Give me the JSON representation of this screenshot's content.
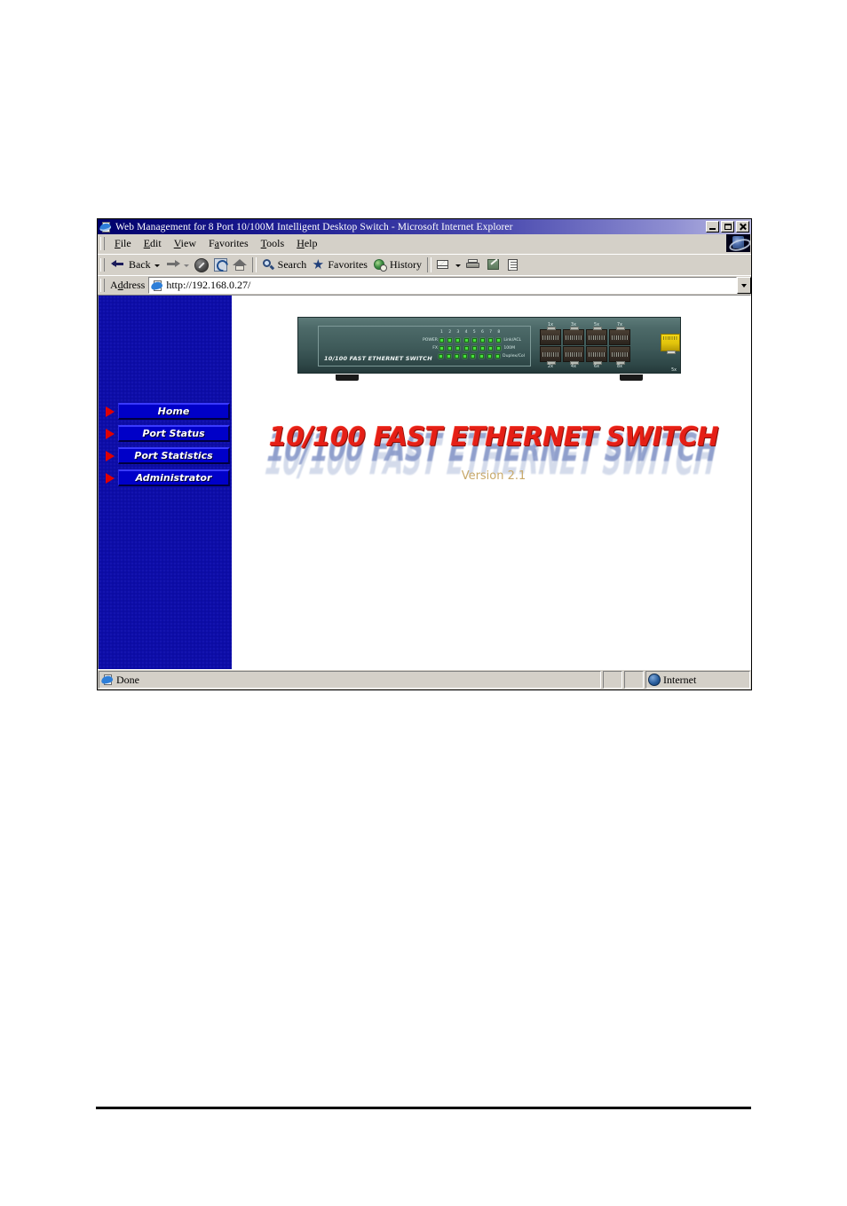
{
  "window": {
    "title": "Web Management for 8 Port 10/100M Intelligent Desktop Switch - Microsoft Internet Explorer",
    "icon": "ie-document-icon",
    "controls": {
      "minimize": "_",
      "restore": "□",
      "close": "✕"
    }
  },
  "menu": {
    "items": [
      {
        "accel": "F",
        "rest": "ile"
      },
      {
        "accel": "E",
        "rest": "dit"
      },
      {
        "accel": "V",
        "rest": "iew"
      },
      {
        "pre": "F",
        "accel": "a",
        "rest": "vorites"
      },
      {
        "accel": "T",
        "rest": "ools"
      },
      {
        "accel": "H",
        "rest": "elp"
      }
    ],
    "labels": [
      "File",
      "Edit",
      "View",
      "Favorites",
      "Tools",
      "Help"
    ]
  },
  "toolbar": {
    "back": "Back",
    "forward": "",
    "stop": "",
    "refresh": "",
    "home": "",
    "search": "Search",
    "favorites": "Favorites",
    "history": "History",
    "mail": "",
    "print": "",
    "edit": "",
    "discuss": ""
  },
  "address": {
    "label_pre": "A",
    "label_accel": "d",
    "label_post": "dress",
    "label": "Address",
    "url": "http://192.168.0.27/",
    "placeholder": "http://"
  },
  "sidebar": {
    "items": [
      {
        "label": "Home"
      },
      {
        "label": "Port Status"
      },
      {
        "label": "Port Statistics"
      },
      {
        "label": "Administrator"
      }
    ]
  },
  "content": {
    "device": {
      "brand": "10/100 FAST ETHERNET SWITCH",
      "port_numbers_top": [
        "1x",
        "3x",
        "5x",
        "7x"
      ],
      "port_numbers_bottom": [
        "2x",
        "4x",
        "6x",
        "8x"
      ],
      "uplink_label": "5x",
      "led_column_numbers": [
        "1",
        "2",
        "3",
        "4",
        "5",
        "6",
        "7",
        "8"
      ],
      "led_rows": [
        {
          "left": "POWER",
          "right": "Link/ACL"
        },
        {
          "left": "FX",
          "right": "100M"
        },
        {
          "left": "",
          "right": "Duplex/Col"
        }
      ]
    },
    "banner_title": "10/100 FAST ETHERNET SWITCH",
    "version": "Version 2.1"
  },
  "statusbar": {
    "status": "Done",
    "zone": "Internet"
  },
  "colors": {
    "titlebar_start": "#00006b",
    "titlebar_end": "#b9b9e2",
    "chrome": "#d4d0c8",
    "sidebar_bg": "#0d0da8",
    "nav_button": "#0000c8",
    "nav_bullet": "#e00000",
    "banner_red": "#e51f16",
    "banner_shadow_blue": "#7d8fc4",
    "version_tan": "#c8a96a",
    "led_green": "#46e23c",
    "uplink_yellow": "#f2d615"
  }
}
